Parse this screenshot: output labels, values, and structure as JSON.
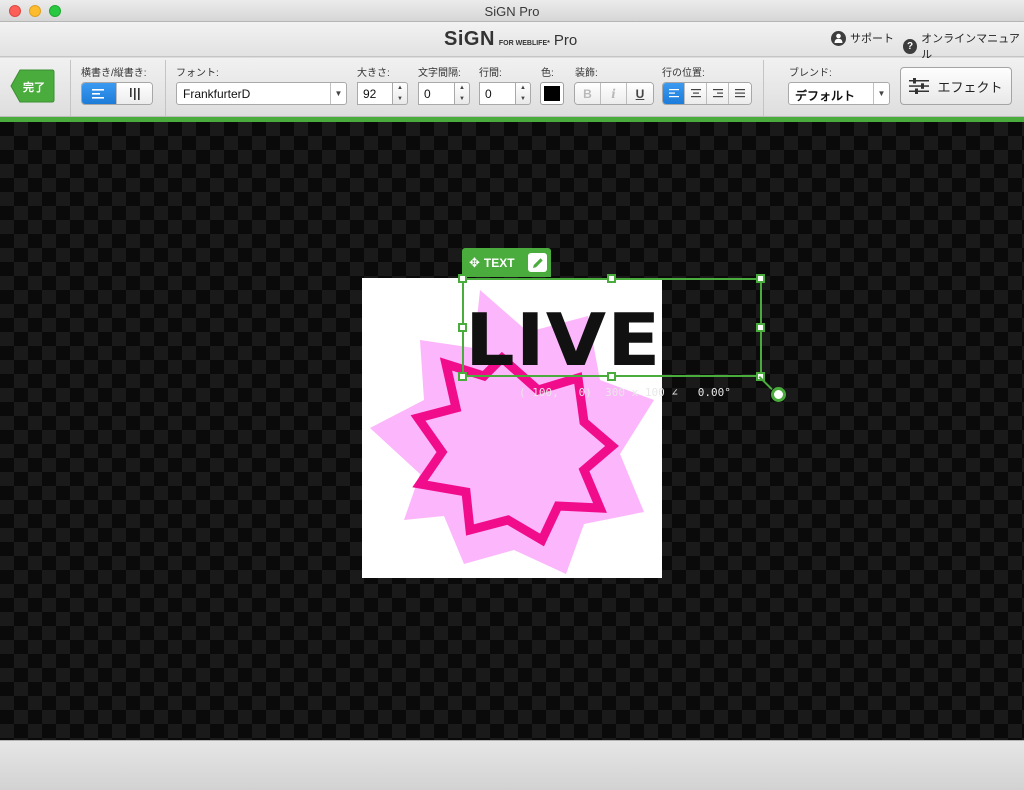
{
  "window": {
    "title": "SiGN Pro"
  },
  "header": {
    "logo_main": "SiGN",
    "logo_sub": "FOR WEBLIFE*",
    "logo_pro": "Pro",
    "support_label": "サポート",
    "manual_label": "オンラインマニュアル"
  },
  "toolbar": {
    "done_label": "完了",
    "orientation_label": "横書き/縦書き:",
    "font_label": "フォント:",
    "font_value": "FrankfurterD",
    "size_label": "大きさ:",
    "size_value": "92",
    "letter_spacing_label": "文字間隔:",
    "letter_spacing_value": "0",
    "line_spacing_label": "行間:",
    "line_spacing_value": "0",
    "color_label": "色:",
    "color_value": "#000000",
    "decoration_label": "装飾:",
    "bold_label": "B",
    "italic_label": "i",
    "underline_label": "U",
    "align_label": "行の位置:",
    "blend_label": "ブレンド:",
    "blend_value": "デフォルト",
    "effect_label": "エフェクト"
  },
  "canvas": {
    "layer_text": "LIVE",
    "selection_tab_label": "TEXT",
    "transform_readout": "( 100,   0)  300 x 100 ∠   0.00°"
  },
  "colors": {
    "accent_green": "#4aac3d",
    "burst_light_pink": "#fcb6fb",
    "burst_hot_pink": "#f10c8c",
    "active_blue": "#1c7cd9"
  }
}
